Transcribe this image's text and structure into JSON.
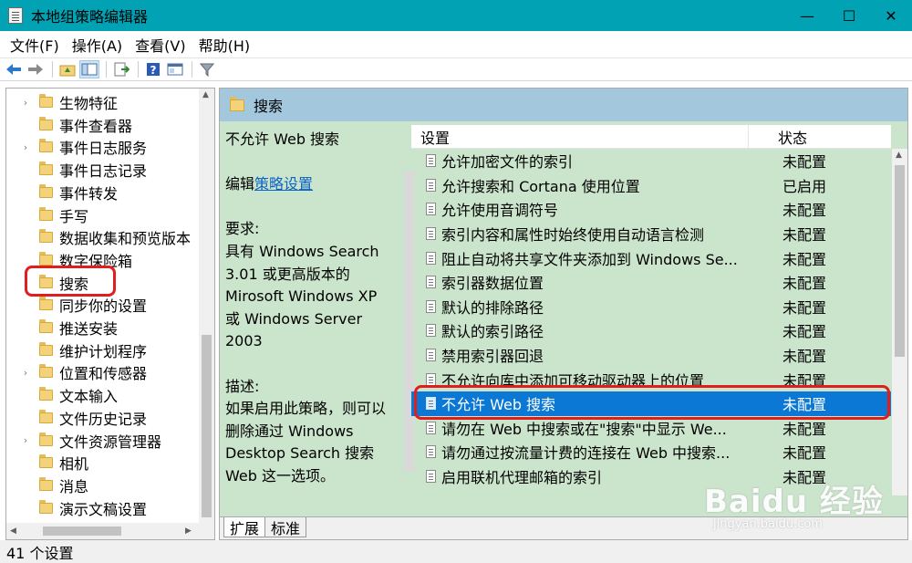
{
  "window": {
    "title": "本地组策略编辑器",
    "controls": [
      "—",
      "☐",
      "✕"
    ]
  },
  "menu": [
    "文件(F)",
    "操作(A)",
    "查看(V)",
    "帮助(H)"
  ],
  "toolbar": {
    "icons": [
      "back-arrow-icon",
      "forward-arrow-icon",
      "up-folder-icon",
      "show-hide-tree-icon",
      "export-list-icon",
      "help-icon",
      "properties-icon",
      "filter-icon"
    ]
  },
  "tree": {
    "items": [
      {
        "label": "生物特征",
        "expandable": true
      },
      {
        "label": "事件查看器",
        "expandable": false
      },
      {
        "label": "事件日志服务",
        "expandable": true
      },
      {
        "label": "事件日志记录",
        "expandable": false
      },
      {
        "label": "事件转发",
        "expandable": false
      },
      {
        "label": "手写",
        "expandable": false
      },
      {
        "label": "数据收集和预览版本",
        "expandable": false
      },
      {
        "label": "数字保险箱",
        "expandable": false
      },
      {
        "label": "搜索",
        "expandable": false
      },
      {
        "label": "同步你的设置",
        "expandable": false
      },
      {
        "label": "推送安装",
        "expandable": false
      },
      {
        "label": "维护计划程序",
        "expandable": false
      },
      {
        "label": "位置和传感器",
        "expandable": true
      },
      {
        "label": "文本输入",
        "expandable": false
      },
      {
        "label": "文件历史记录",
        "expandable": false
      },
      {
        "label": "文件资源管理器",
        "expandable": true
      },
      {
        "label": "相机",
        "expandable": false
      },
      {
        "label": "消息",
        "expandable": false
      },
      {
        "label": "演示文稿设置",
        "expandable": false
      }
    ]
  },
  "right": {
    "header": "搜索",
    "description": {
      "title": "不允许 Web 搜索",
      "edit_prefix": "编辑",
      "edit_link": "策略设置",
      "requirements_label": "要求:",
      "requirements_lines": [
        "具有 Windows Search",
        "3.01 或更高版本的",
        "Mirosoft Windows XP",
        "或 Windows Server",
        "2003"
      ],
      "desc_label": "描述:",
      "desc_lines": [
        "如果启用此策略，则可以",
        "删除通过 Windows",
        "Desktop Search 搜索",
        "Web 这一选项。"
      ]
    },
    "columns": {
      "setting": "设置",
      "state": "状态"
    },
    "rows": [
      {
        "name": "允许加密文件的索引",
        "state": "未配置"
      },
      {
        "name": "允许搜索和 Cortana 使用位置",
        "state": "已启用"
      },
      {
        "name": "允许使用音调符号",
        "state": "未配置"
      },
      {
        "name": "索引内容和属性时始终使用自动语言检测",
        "state": "未配置"
      },
      {
        "name": "阻止自动将共享文件夹添加到 Windows Se...",
        "state": "未配置"
      },
      {
        "name": "索引器数据位置",
        "state": "未配置"
      },
      {
        "name": "默认的排除路径",
        "state": "未配置"
      },
      {
        "name": "默认的索引路径",
        "state": "未配置"
      },
      {
        "name": "禁用索引器回退",
        "state": "未配置"
      },
      {
        "name": "不允许向库中添加可移动驱动器上的位置",
        "state": "未配置"
      },
      {
        "name": "不允许 Web 搜索",
        "state": "未配置",
        "selected": true
      },
      {
        "name": "请勿在 Web 中搜索或在\"搜索\"中显示 We...",
        "state": "未配置"
      },
      {
        "name": "请勿通过按流量计费的连接在 Web 中搜索...",
        "state": "未配置"
      },
      {
        "name": "启用联机代理邮箱的索引",
        "state": "未配置"
      }
    ],
    "tabs": [
      "扩展",
      "标准"
    ]
  },
  "status": "41 个设置",
  "watermark": {
    "logo": "Baidu 经验",
    "sub": "jingyan.baidu.com"
  },
  "colors": {
    "titlebar": "#00a2b4",
    "selection": "#0a78d4",
    "pane_bg": "#cbe4cc",
    "highlight": "#e01e1e"
  }
}
